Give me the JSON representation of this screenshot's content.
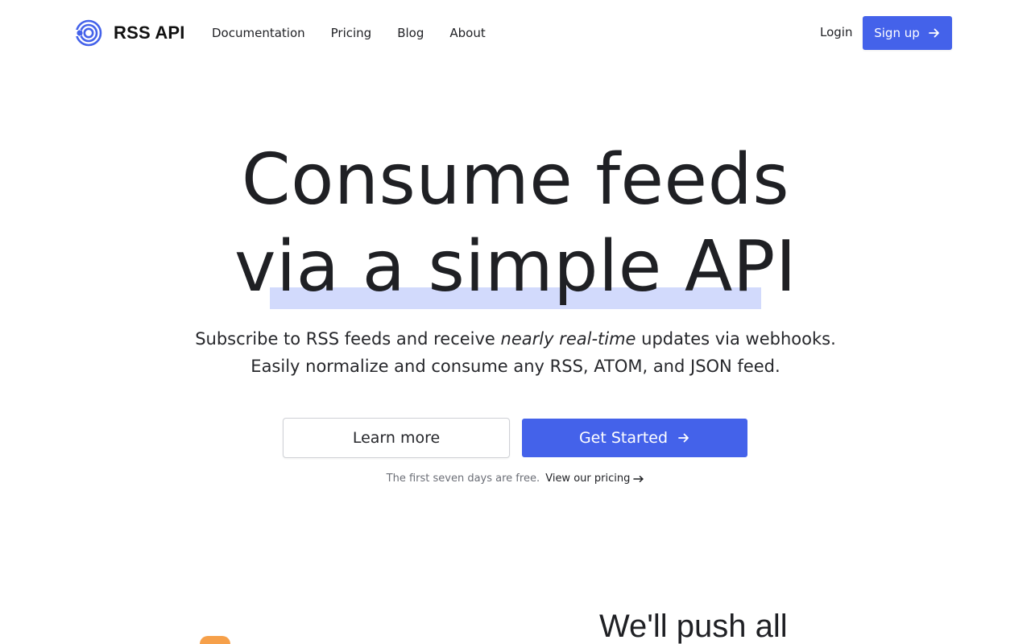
{
  "brand": {
    "name": "RSS API",
    "logo_icon": "rss-api-logo-icon",
    "color": "#4462ea"
  },
  "nav": {
    "links": [
      "Documentation",
      "Pricing",
      "Blog",
      "About"
    ],
    "login": "Login",
    "signup": "Sign up"
  },
  "hero": {
    "headline_line1": "Consume feeds",
    "headline_line2": "via a simple API",
    "sub_line1_before": "Subscribe to RSS feeds and receive ",
    "sub_line1_emphasis": "nearly real-time",
    "sub_line1_after": " updates via webhooks.",
    "sub_line2": "Easily normalize and consume any RSS, ATOM, and JSON feed.",
    "learn_more": "Learn more",
    "get_started": "Get Started",
    "fineprint": "The first seven days are free.",
    "pricing_link": "View our pricing"
  },
  "features": {
    "heading": "We'll push all",
    "badge_icon": "rss-feed-icon"
  },
  "colors": {
    "accent": "#4462ea",
    "highlight": "#d2dafc",
    "rss_orange": "#f6a04a"
  }
}
